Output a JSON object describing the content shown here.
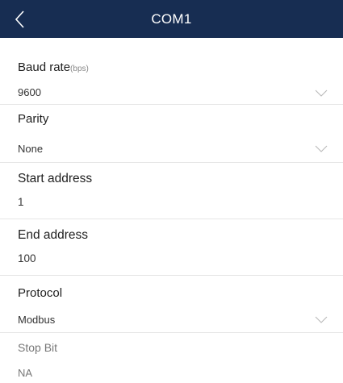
{
  "header": {
    "title": "COM1",
    "back_icon": "chevron-left-icon",
    "background_color": "#172d52"
  },
  "settings": [
    {
      "key": "baud_rate",
      "label": "Baud rate",
      "unit": "(bps)",
      "value": "9600",
      "dropdown": true
    },
    {
      "key": "parity",
      "label": "Parity",
      "value": "None",
      "dropdown": true
    },
    {
      "key": "start_address",
      "label": "Start address",
      "value": "1",
      "dropdown": false
    },
    {
      "key": "end_address",
      "label": "End address",
      "value": "100",
      "dropdown": false
    },
    {
      "key": "protocol",
      "label": "Protocol",
      "value": "Modbus",
      "dropdown": true
    },
    {
      "key": "stop_bit",
      "label": "Stop Bit",
      "value": "NA",
      "dropdown": false,
      "disabled": true
    }
  ],
  "chevron_icon": "chevron-down-icon"
}
